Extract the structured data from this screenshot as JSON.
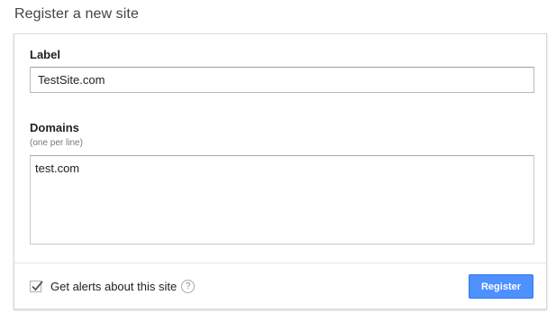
{
  "page": {
    "title": "Register a new site"
  },
  "form": {
    "label": {
      "title": "Label",
      "value": "TestSite.com"
    },
    "domains": {
      "title": "Domains",
      "hint": "(one per line)",
      "value": "test.com"
    },
    "alerts": {
      "label": "Get alerts about this site",
      "checked": true,
      "help_icon": "question-circle-icon",
      "help_glyph": "?"
    },
    "register_button": {
      "label": "Register",
      "color": "#4d90fe"
    }
  }
}
